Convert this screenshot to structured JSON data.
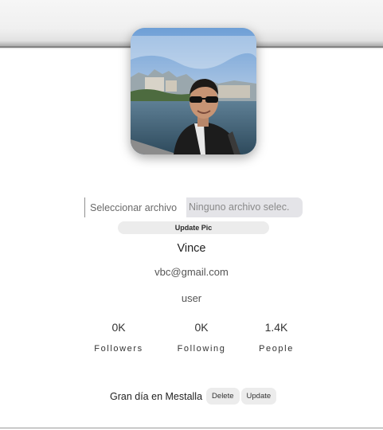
{
  "profile": {
    "avatar_alt": "profile photo",
    "name": "Vince",
    "email": "vbc@gmail.com",
    "role": "user"
  },
  "file_input": {
    "button_label": "Seleccionar archivo",
    "status_text": "Ninguno archivo selec."
  },
  "update_pic_label": "Update Pic",
  "stats": [
    {
      "value": "0K",
      "label": "Followers"
    },
    {
      "value": "0K",
      "label": "Following"
    },
    {
      "value": "1.4K",
      "label": "People"
    }
  ],
  "post": {
    "text": "Gran día en Mestalla",
    "delete_label": "Delete",
    "update_label": "Update"
  },
  "colors": {
    "button_bg": "#ececec",
    "file_input_bg": "#e4e4e8",
    "text": "#333333"
  }
}
